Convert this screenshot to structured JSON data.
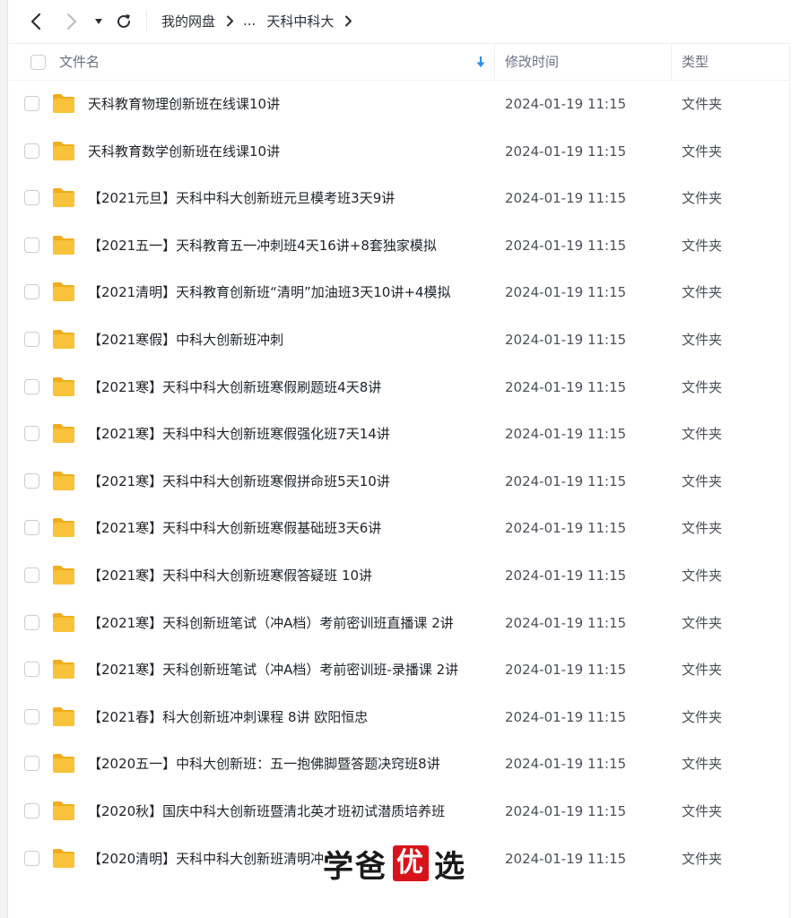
{
  "toolbar": {
    "back_icon": "chevron-left-icon",
    "forward_icon": "chevron-right-icon",
    "history_icon": "caret-down-icon",
    "refresh_icon": "refresh-icon"
  },
  "breadcrumb": {
    "root": "我的网盘",
    "ellipsis": "...",
    "current": "天科中科大",
    "separator": ">"
  },
  "table": {
    "columns": {
      "name": "文件名",
      "modified": "修改时间",
      "type": "类型"
    },
    "sort_icon": "sort-down-arrow-icon",
    "rows": [
      {
        "name": "天科教育物理创新班在线课10讲",
        "modified": "2024-01-19 11:15",
        "type": "文件夹"
      },
      {
        "name": "天科教育数学创新班在线课10讲",
        "modified": "2024-01-19 11:15",
        "type": "文件夹"
      },
      {
        "name": "【2021元旦】天科中科大创新班元旦模考班3天9讲",
        "modified": "2024-01-19 11:15",
        "type": "文件夹"
      },
      {
        "name": "【2021五一】天科教育五一冲刺班4天16讲+8套独家模拟",
        "modified": "2024-01-19 11:15",
        "type": "文件夹"
      },
      {
        "name": "【2021清明】天科教育创新班“清明”加油班3天10讲+4模拟",
        "modified": "2024-01-19 11:15",
        "type": "文件夹"
      },
      {
        "name": "【2021寒假】中科大创新班冲刺",
        "modified": "2024-01-19 11:15",
        "type": "文件夹"
      },
      {
        "name": "【2021寒】天科中科大创新班寒假刷题班4天8讲",
        "modified": "2024-01-19 11:15",
        "type": "文件夹"
      },
      {
        "name": "【2021寒】天科中科大创新班寒假强化班7天14讲",
        "modified": "2024-01-19 11:15",
        "type": "文件夹"
      },
      {
        "name": "【2021寒】天科中科大创新班寒假拼命班5天10讲",
        "modified": "2024-01-19 11:15",
        "type": "文件夹"
      },
      {
        "name": "【2021寒】天科中科大创新班寒假基础班3天6讲",
        "modified": "2024-01-19 11:15",
        "type": "文件夹"
      },
      {
        "name": "【2021寒】天科中科大创新班寒假答疑班 10讲",
        "modified": "2024-01-19 11:15",
        "type": "文件夹"
      },
      {
        "name": "【2021寒】天科创新班笔试（冲A档）考前密训班直播课 2讲",
        "modified": "2024-01-19 11:15",
        "type": "文件夹"
      },
      {
        "name": "【2021寒】天科创新班笔试（冲A档）考前密训班-录播课 2讲",
        "modified": "2024-01-19 11:15",
        "type": "文件夹"
      },
      {
        "name": "【2021春】科大创新班冲刺课程 8讲 欧阳恒忠",
        "modified": "2024-01-19 11:15",
        "type": "文件夹"
      },
      {
        "name": "【2020五一】中科大创新班：五一抱佛脚暨答题决窍班8讲",
        "modified": "2024-01-19 11:15",
        "type": "文件夹"
      },
      {
        "name": "【2020秋】国庆中科大创新班暨清北英才班初试潜质培养班",
        "modified": "2024-01-19 11:15",
        "type": "文件夹"
      },
      {
        "name": "【2020清明】天科中科大创新班清明冲",
        "modified": "2024-01-19 11:15",
        "type": "文件夹"
      }
    ]
  },
  "folder_icon": "folder-icon",
  "colors": {
    "folder": "#f8c23a",
    "folder_tab": "#f0ad1c",
    "sort_arrow": "#2a8cf0",
    "watermark_seal": "#d8141b"
  },
  "watermark": {
    "left": "学爸",
    "seal": "优",
    "right": "选"
  }
}
